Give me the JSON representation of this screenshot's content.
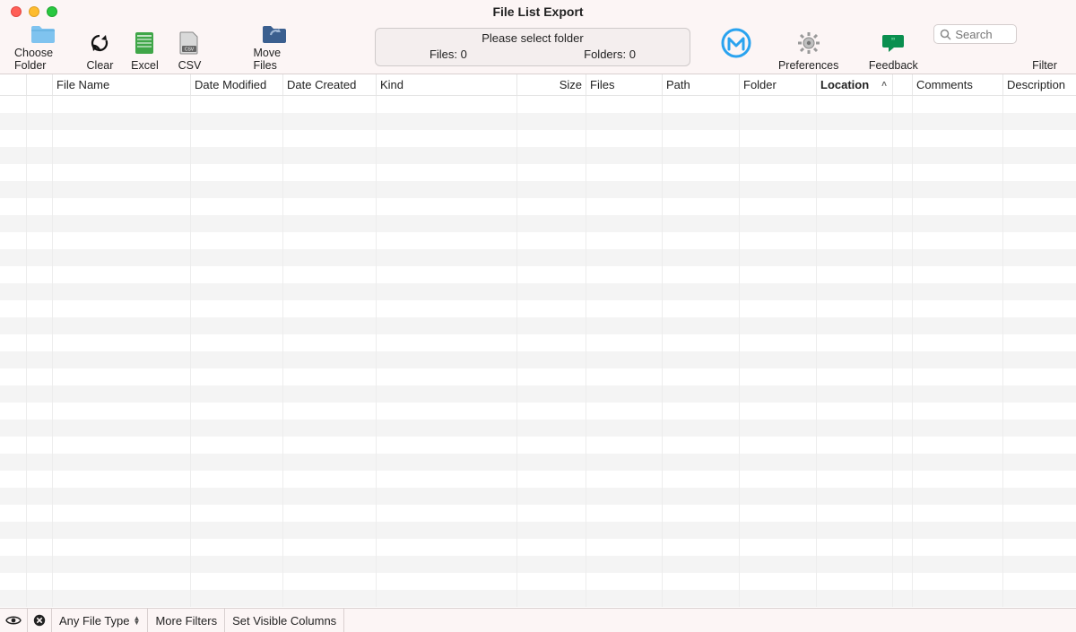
{
  "window": {
    "title": "File List Export"
  },
  "toolbar": {
    "choose_folder": "Choose Folder",
    "clear": "Clear",
    "excel": "Excel",
    "csv": "CSV",
    "move_files": "Move Files",
    "preferences": "Preferences",
    "feedback": "Feedback",
    "filter": "Filter"
  },
  "status": {
    "prompt": "Please select folder",
    "files_label": "Files: 0",
    "folders_label": "Folders: 0"
  },
  "search": {
    "placeholder": "Search"
  },
  "columns": [
    {
      "label": ""
    },
    {
      "label": ""
    },
    {
      "label": "File Name"
    },
    {
      "label": "Date Modified"
    },
    {
      "label": "Date Created"
    },
    {
      "label": "Kind"
    },
    {
      "label": "Size"
    },
    {
      "label": "Files"
    },
    {
      "label": "Path"
    },
    {
      "label": "Folder"
    },
    {
      "label": "Location",
      "sorted": true
    },
    {
      "label": ""
    },
    {
      "label": "Comments"
    },
    {
      "label": "Description"
    }
  ],
  "bottom": {
    "any_file_type": "Any File Type",
    "more_filters": "More Filters",
    "set_visible_columns": "Set Visible Columns"
  }
}
